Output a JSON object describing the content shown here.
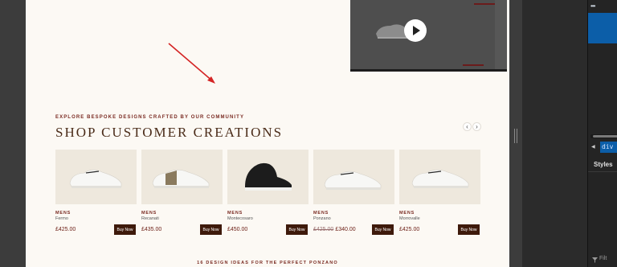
{
  "section": {
    "eyebrow": "EXPLORE BESPOKE DESIGNS CRAFTED BY OUR COMMUNITY",
    "title": "SHOP CUSTOMER CREATIONS",
    "prev_icon": "chevron-left-icon",
    "next_icon": "chevron-right-icon",
    "prev_glyph": "‹",
    "next_glyph": "›"
  },
  "products": [
    {
      "category": "MENS",
      "name": "Fermo",
      "old_price": "",
      "price": "£425.00",
      "buy_label": "Buy Now",
      "shoe": "white-low"
    },
    {
      "category": "MENS",
      "name": "Recanati",
      "old_price": "",
      "price": "£435.00",
      "buy_label": "Buy Now",
      "shoe": "white-stripe"
    },
    {
      "category": "MENS",
      "name": "Montecosaro",
      "old_price": "",
      "price": "£450.00",
      "buy_label": "Buy Now",
      "shoe": "black-high"
    },
    {
      "category": "MENS",
      "name": "Ponzano",
      "old_price": "£425.00",
      "price": "£340.00",
      "buy_label": "Buy Now",
      "shoe": "white-low"
    },
    {
      "category": "MENS",
      "name": "Morrovalle",
      "old_price": "",
      "price": "£425.00",
      "buy_label": "Buy Now",
      "shoe": "white-low"
    }
  ],
  "footer_note": "16 DESIGN IDEAS FOR THE PERFECT PONZANO",
  "video": {
    "play_icon": "play-icon"
  },
  "devtools": {
    "dots": "•••",
    "element_tag": "div",
    "styles_tab": "Styles",
    "filter_placeholder": "Filt",
    "caret": "◀"
  },
  "colors": {
    "accent": "#7a2b22",
    "buy_button": "#3e1a0b",
    "page_bg": "#fcf9f4",
    "card_bg": "#eee8dd",
    "devtools_blue": "#0c5ea8"
  }
}
